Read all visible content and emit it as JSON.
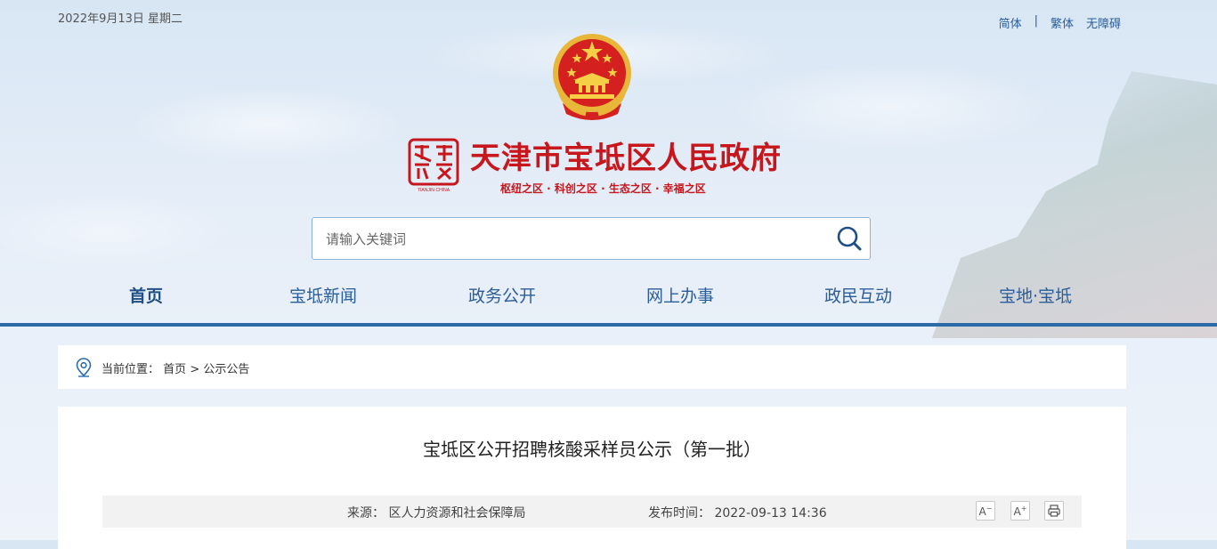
{
  "header": {
    "date": "2022年9月13日 星期二",
    "lang_links": [
      "简体",
      "繁体",
      "无障碍"
    ],
    "lang_separator": "|",
    "site_title": "天津市宝坻区人民政府",
    "slogan": "枢纽之区 · 科创之区 · 生态之区 · 幸福之区",
    "seal_text": "TIANJIN·CHINA"
  },
  "search": {
    "placeholder": "请输入关键词"
  },
  "nav": {
    "items": [
      "首页",
      "宝坻新闻",
      "政务公开",
      "网上办事",
      "政民互动",
      "宝地·宝坻"
    ],
    "active_index": 0
  },
  "breadcrumb": {
    "label": "当前位置：",
    "home": "首页",
    "separator": ">",
    "current": "公示公告"
  },
  "article": {
    "title": "宝坻区公开招聘核酸采样员公示（第一批）",
    "source": "来源：  区人力资源和社会保障局",
    "publish_time": "发布时间：  2022-09-13 14:36",
    "tools": {
      "font_decrease": "A",
      "font_increase": "A"
    }
  },
  "colors": {
    "brand_red": "#c8161d",
    "nav_blue": "#2a5d9a",
    "nav_line": "#2d6aa8"
  }
}
